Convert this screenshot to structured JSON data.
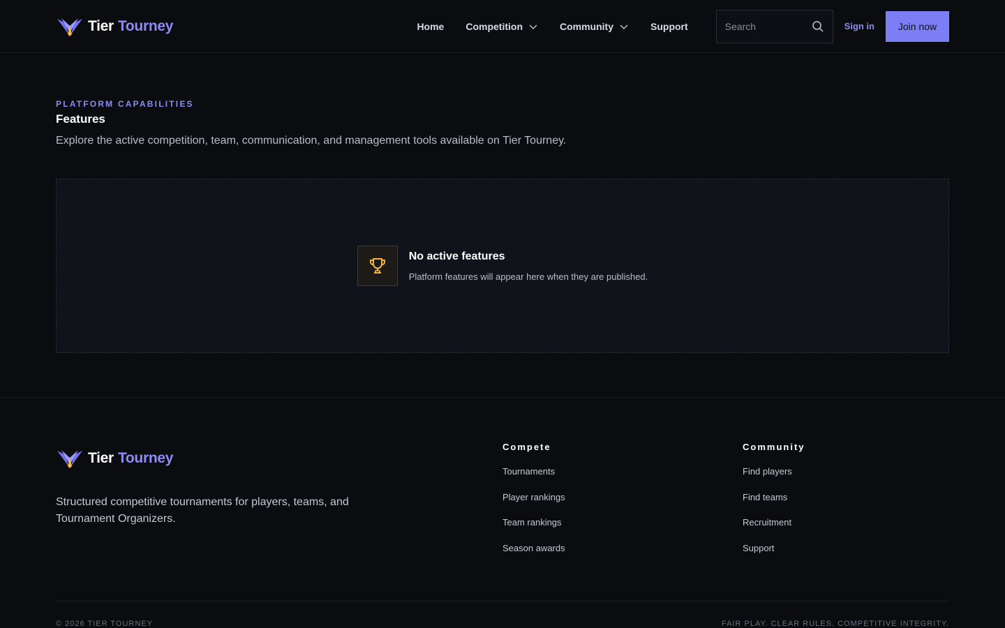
{
  "brand": {
    "name_part1": "Tier",
    "name_part2": "Tourney",
    "accent_color": "#8b8cf6"
  },
  "nav": {
    "items": [
      {
        "label": "Home",
        "has_dropdown": false
      },
      {
        "label": "Competition",
        "has_dropdown": true
      },
      {
        "label": "Community",
        "has_dropdown": true
      },
      {
        "label": "Support",
        "has_dropdown": false
      }
    ],
    "search_placeholder": "Search",
    "sign_in": "Sign in",
    "join_now": "Join now"
  },
  "main": {
    "eyebrow": "PLATFORM CAPABILITIES",
    "title": "Features",
    "description": "Explore the active competition, team, communication, and management tools available on Tier Tourney.",
    "empty_state": {
      "icon": "trophy-icon",
      "title": "No active features",
      "description": "Platform features will appear here when they are published."
    }
  },
  "footer": {
    "tagline": "Structured competitive tournaments for players, teams, and Tournament Organizers.",
    "columns": [
      {
        "title": "Compete",
        "links": [
          "Tournaments",
          "Player rankings",
          "Team rankings",
          "Season awards"
        ]
      },
      {
        "title": "Community",
        "links": [
          "Find players",
          "Find teams",
          "Recruitment",
          "Support"
        ]
      }
    ],
    "copyright": "© 2026 TIER TOURNEY",
    "motto": "FAIR PLAY. CLEAR RULES. COMPETITIVE INTEGRITY."
  }
}
